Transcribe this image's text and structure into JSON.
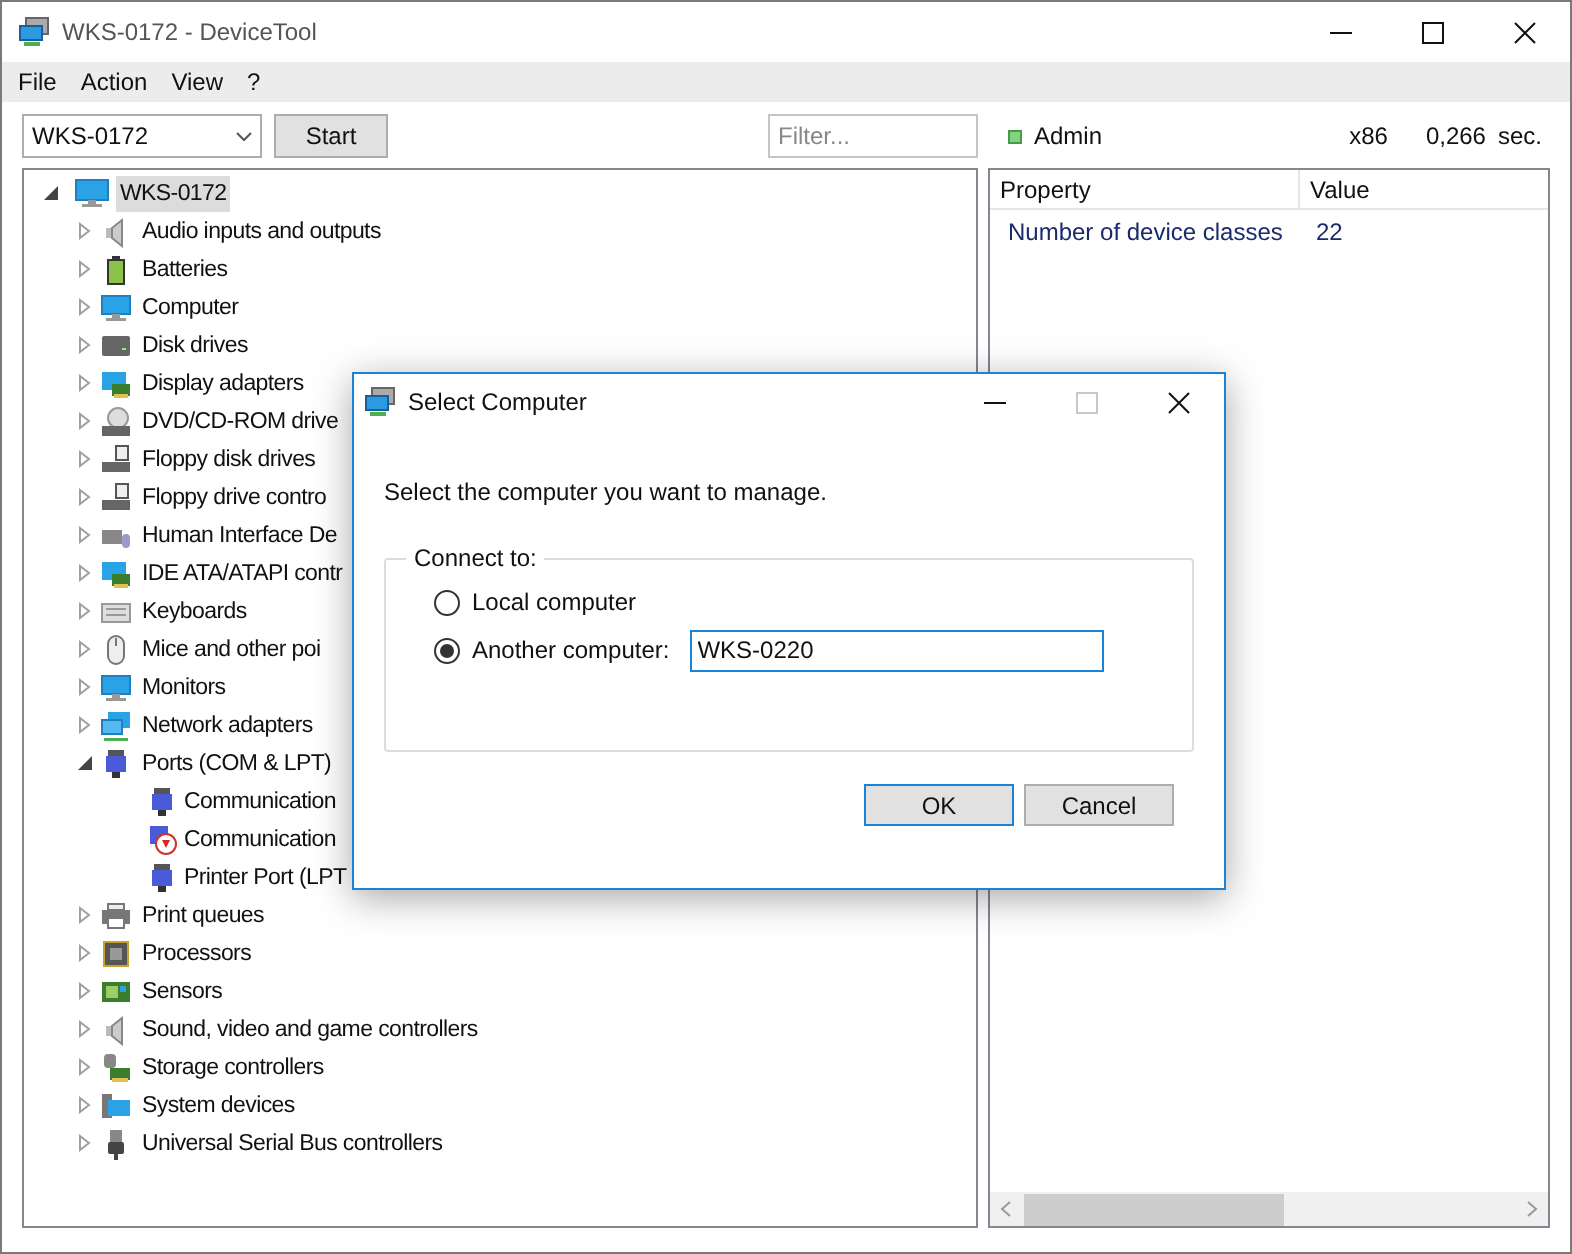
{
  "window": {
    "title": "WKS-0172 - DeviceTool"
  },
  "menu": [
    "File",
    "Action",
    "View",
    "?"
  ],
  "toolbar": {
    "computer": "WKS-0172",
    "start": "Start",
    "filter_placeholder": "Filter...",
    "user": "Admin",
    "arch": "x86",
    "time": "0,266",
    "time_unit": "sec."
  },
  "tree": [
    {
      "label": "WKS-0172",
      "expanded": true,
      "selected": true,
      "children": [
        {
          "label": "Audio inputs and outputs",
          "expanded": false,
          "selected": false
        },
        {
          "label": "Batteries",
          "expanded": false,
          "selected": false
        },
        {
          "label": "Computer",
          "expanded": false,
          "selected": false
        },
        {
          "label": "Disk drives",
          "expanded": false,
          "selected": false
        },
        {
          "label": "Display adapters",
          "expanded": false,
          "selected": false
        },
        {
          "label": "DVD/CD-ROM drive",
          "expanded": false,
          "selected": false
        },
        {
          "label": "Floppy disk drives",
          "expanded": false,
          "selected": false
        },
        {
          "label": "Floppy drive contro",
          "expanded": false,
          "selected": false
        },
        {
          "label": "Human Interface De",
          "expanded": false,
          "selected": false
        },
        {
          "label": "IDE ATA/ATAPI contr",
          "expanded": false,
          "selected": false
        },
        {
          "label": "Keyboards",
          "expanded": false,
          "selected": false
        },
        {
          "label": "Mice and other poi",
          "expanded": false,
          "selected": false
        },
        {
          "label": "Monitors",
          "expanded": false,
          "selected": false
        },
        {
          "label": "Network adapters",
          "expanded": false,
          "selected": false
        },
        {
          "label": "Ports (COM & LPT)",
          "expanded": true,
          "selected": false,
          "children": [
            {
              "label": "Communication",
              "selected": false
            },
            {
              "label": "Communication",
              "selected": false
            },
            {
              "label": "Printer Port (LPT",
              "selected": false
            }
          ]
        },
        {
          "label": "Print queues",
          "expanded": false,
          "selected": false
        },
        {
          "label": "Processors",
          "expanded": false,
          "selected": false
        },
        {
          "label": "Sensors",
          "expanded": false,
          "selected": false
        },
        {
          "label": "Sound, video and game controllers",
          "expanded": false,
          "selected": false
        },
        {
          "label": "Storage controllers",
          "expanded": false,
          "selected": false
        },
        {
          "label": "System devices",
          "expanded": false,
          "selected": false
        },
        {
          "label": "Universal Serial Bus controllers",
          "expanded": false,
          "selected": false
        }
      ]
    }
  ],
  "properties": {
    "columns": [
      "Property",
      "Value"
    ],
    "rows": [
      [
        "Number of device classes",
        "22"
      ]
    ]
  },
  "dialog": {
    "title": "Select Computer",
    "prompt": "Select the computer you want to manage.",
    "group": "Connect to:",
    "options": [
      {
        "label": "Local computer",
        "selected": false
      },
      {
        "label": "Another computer:",
        "selected": true
      }
    ],
    "computer_value": "WKS-0220",
    "buttons": [
      {
        "label": "OK",
        "default": true
      },
      {
        "label": "Cancel",
        "default": false
      }
    ]
  }
}
